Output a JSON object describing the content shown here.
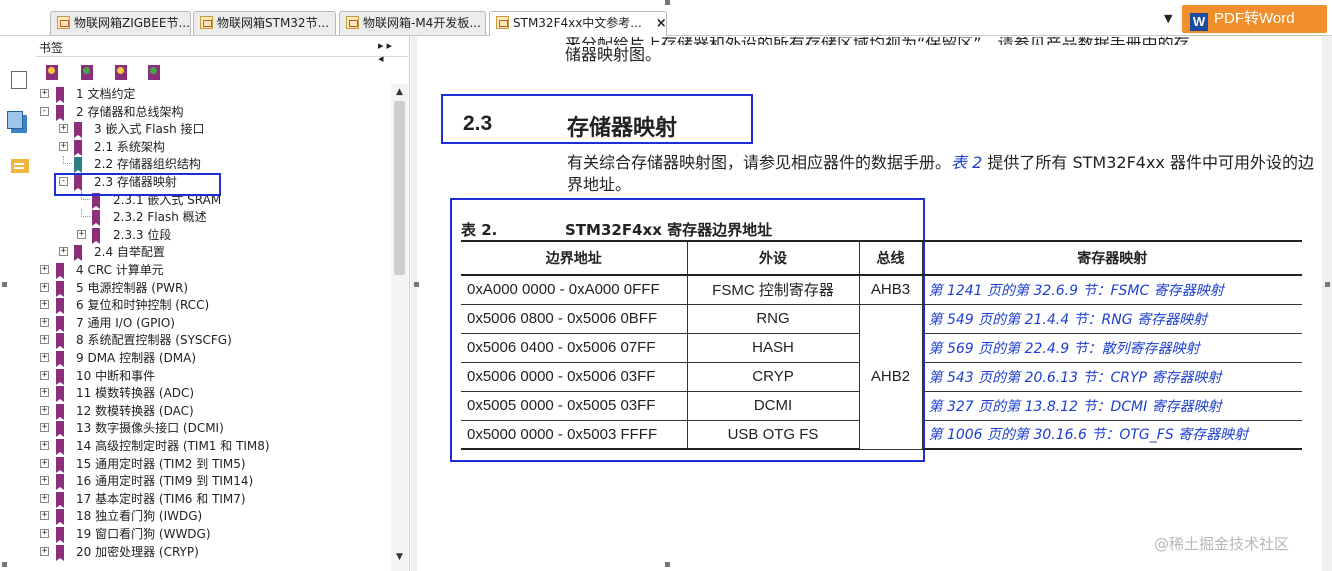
{
  "tabs": [
    {
      "title": "物联网箱ZIGBEE节...",
      "active": false
    },
    {
      "title": "物联网箱STM32节...",
      "active": false
    },
    {
      "title": "物联网箱-M4开发板...",
      "active": false
    },
    {
      "title": "STM32F4xx中文参考...",
      "active": true
    }
  ],
  "tab_close": "×",
  "tab_dropdown": "▼",
  "pdf_word": {
    "badge": "W",
    "label": "PDF转Word"
  },
  "bookmarks": {
    "title": "书签",
    "collapse_arrows": "▸▸ ◂",
    "items": [
      {
        "label": "1 文档约定",
        "level": 0,
        "toggle": "+"
      },
      {
        "label": "2 存储器和总线架构",
        "level": 0,
        "toggle": "-"
      },
      {
        "label": "3 嵌入式 Flash 接口",
        "level": 1,
        "toggle": "+"
      },
      {
        "label": "2.1 系统架构",
        "level": 1,
        "toggle": "+"
      },
      {
        "label": "2.2 存储器组织结构",
        "level": 1,
        "toggle": "",
        "teal": true
      },
      {
        "label": "2.3 存储器映射",
        "level": 1,
        "toggle": "-",
        "selected": true
      },
      {
        "label": "2.3.1 嵌入式 SRAM",
        "level": 2,
        "toggle": ""
      },
      {
        "label": "2.3.2 Flash 概述",
        "level": 2,
        "toggle": ""
      },
      {
        "label": "2.3.3 位段",
        "level": 2,
        "toggle": "+"
      },
      {
        "label": "2.4 自举配置",
        "level": 1,
        "toggle": "+"
      },
      {
        "label": "4 CRC 计算单元",
        "level": 0,
        "toggle": "+"
      },
      {
        "label": "5 电源控制器 (PWR)",
        "level": 0,
        "toggle": "+"
      },
      {
        "label": "6 复位和时钟控制 (RCC)",
        "level": 0,
        "toggle": "+"
      },
      {
        "label": "7 通用 I/O (GPIO)",
        "level": 0,
        "toggle": "+"
      },
      {
        "label": "8 系统配置控制器 (SYSCFG)",
        "level": 0,
        "toggle": "+"
      },
      {
        "label": "9 DMA 控制器 (DMA)",
        "level": 0,
        "toggle": "+"
      },
      {
        "label": "10 中断和事件",
        "level": 0,
        "toggle": "+"
      },
      {
        "label": "11 模数转换器 (ADC)",
        "level": 0,
        "toggle": "+"
      },
      {
        "label": "12 数模转换器 (DAC)",
        "level": 0,
        "toggle": "+"
      },
      {
        "label": "13 数字摄像头接口 (DCMI)",
        "level": 0,
        "toggle": "+"
      },
      {
        "label": "14 高级控制定时器 (TIM1 和 TIM8)",
        "level": 0,
        "toggle": "+"
      },
      {
        "label": "15 通用定时器 (TIM2 到 TIM5)",
        "level": 0,
        "toggle": "+"
      },
      {
        "label": "16 通用定时器 (TIM9 到 TIM14)",
        "level": 0,
        "toggle": "+"
      },
      {
        "label": "17 基本定时器 (TIM6 和 TIM7)",
        "level": 0,
        "toggle": "+"
      },
      {
        "label": "18 独立看门狗 (IWDG)",
        "level": 0,
        "toggle": "+"
      },
      {
        "label": "19 窗口看门狗 (WWDG)",
        "level": 0,
        "toggle": "+"
      },
      {
        "label": "20 加密处理器 (CRYP)",
        "level": 0,
        "toggle": "+"
      }
    ]
  },
  "scroll": {
    "up": "▲",
    "down": "▼"
  },
  "document": {
    "top_line1": "来分配给片上存储器和外设的所有存储区域均视为“保留区”。请参见产品数据手册中的存",
    "top_line2": "储器映射图。",
    "section_number": "2.3",
    "section_title": "存储器映射",
    "para_pre": "有关综合存储器映射图，请参见相应器件的数据手册。",
    "para_link": "表 2",
    "para_post": " 提供了所有 STM32F4xx 器件中可用外设的边界地址。",
    "table_number": "表 2.",
    "table_title": "STM32F4xx 寄存器边界地址",
    "headers": [
      "边界地址",
      "外设",
      "总线",
      "寄存器映射"
    ],
    "rows": [
      {
        "address": "0xA000 0000 - 0xA000 0FFF",
        "peripheral": "FSMC 控制寄存器",
        "bus": "AHB3",
        "map": "第 1241 页的第 32.6.9 节：FSMC 寄存器映射"
      },
      {
        "address": "0x5006 0800 - 0x5006 0BFF",
        "peripheral": "RNG",
        "bus": "AHB2",
        "map": "第 549 页的第 21.4.4 节：RNG 寄存器映射"
      },
      {
        "address": "0x5006 0400 - 0x5006 07FF",
        "peripheral": "HASH",
        "bus": "",
        "map": "第 569 页的第 22.4.9 节：散列寄存器映射"
      },
      {
        "address": "0x5006 0000 - 0x5006 03FF",
        "peripheral": "CRYP",
        "bus": "",
        "map": "第 543 页的第 20.6.13 节：CRYP 寄存器映射"
      },
      {
        "address": "0x5005 0000 - 0x5005 03FF",
        "peripheral": "DCMI",
        "bus": "",
        "map": "第 327 页的第 13.8.12 节：DCMI 寄存器映射"
      },
      {
        "address": "0x5000 0000 - 0x5003 FFFF",
        "peripheral": "USB OTG FS",
        "bus": "",
        "map": "第 1006 页的第 30.16.6 节：OTG_FS 寄存器映射"
      }
    ]
  },
  "watermark": "@稀土掘金技术社区"
}
